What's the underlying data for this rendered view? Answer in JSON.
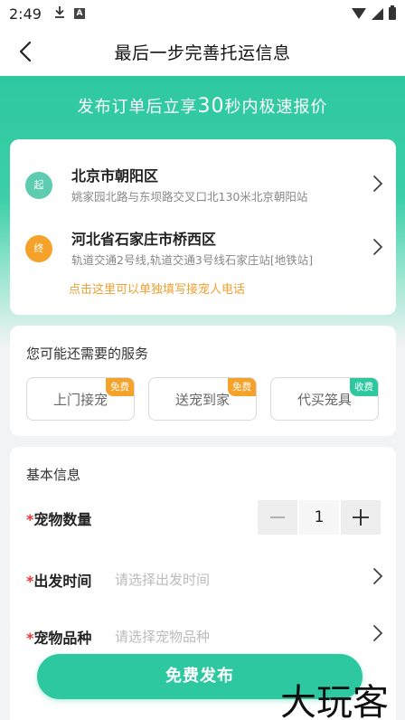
{
  "status_bar": {
    "time": "2:49",
    "download_icon": "download-icon",
    "a_icon_text": "A"
  },
  "nav": {
    "title": "最后一步完善托运信息"
  },
  "hero": {
    "text_before": "发布订单后立享",
    "highlight": "30",
    "text_after": "秒内极速报价"
  },
  "route": {
    "start": {
      "badge": "起",
      "title": "北京市朝阳区",
      "address": "姚家园北路与东坝路交叉口北130米北京朝阳站"
    },
    "end": {
      "badge": "终",
      "title": "河北省石家庄市桥西区",
      "address": "轨道交通2号线,轨道交通3号线石家庄站[地铁站]"
    },
    "phone_link": "点击这里可以单独填写接宠人电话"
  },
  "services": {
    "title": "您可能还需要的服务",
    "items": [
      {
        "label": "上门接宠",
        "tag": "免费"
      },
      {
        "label": "送宠到家",
        "tag": "免费"
      },
      {
        "label": "代买笼具",
        "tag": "收费"
      }
    ]
  },
  "basic_info": {
    "title": "基本信息",
    "required_mark": "*",
    "fields": [
      {
        "label": "宠物数量",
        "value": "1"
      },
      {
        "label": "出发时间",
        "placeholder": "请选择出发时间"
      },
      {
        "label": "宠物品种",
        "placeholder": "请选择宠物品种"
      }
    ]
  },
  "submit_label": "免费发布",
  "watermark": "大玩客",
  "colors": {
    "accent": "#2ec8a0",
    "orange": "#f5a22a",
    "required": "#e53935"
  }
}
